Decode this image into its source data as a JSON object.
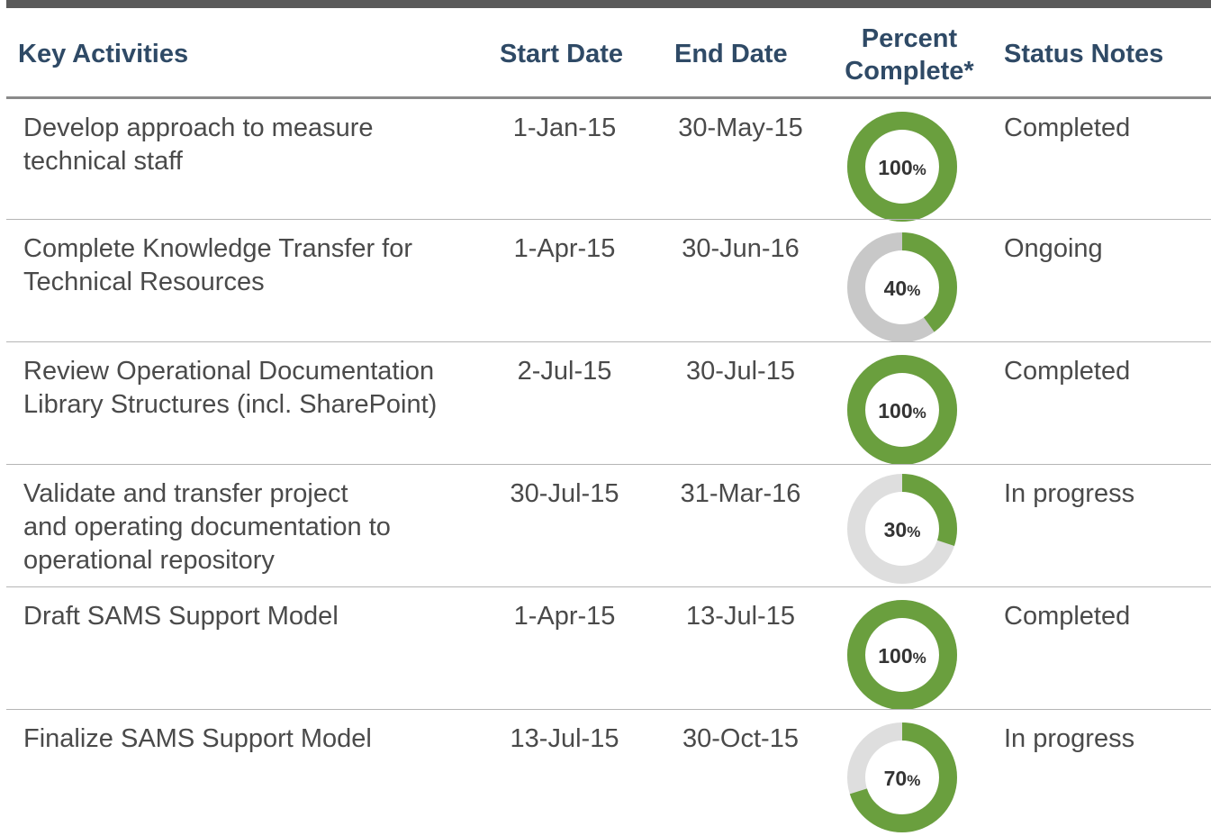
{
  "table": {
    "headers": {
      "activities": "Key Activities",
      "start": "Start Date",
      "end": "End Date",
      "percent_line1": "Percent",
      "percent_line2": "Complete*",
      "status": "Status Notes"
    },
    "rows": [
      {
        "activity_lines": [
          "Develop approach to measure",
          "technical staff"
        ],
        "start": "1-Jan-15",
        "end": "30-May-15",
        "percent": 100,
        "percent_text": "100",
        "status": "Completed",
        "track_color": "#c8c8c8"
      },
      {
        "activity_lines": [
          "Complete Knowledge Transfer for",
          "Technical Resources"
        ],
        "start": "1-Apr-15",
        "end": "30-Jun-16",
        "percent": 40,
        "percent_text": "40",
        "status": "Ongoing",
        "track_color": "#c8c8c8"
      },
      {
        "activity_lines": [
          "Review Operational Documentation",
          "Library Structures (incl. SharePoint)"
        ],
        "start": "2-Jul-15",
        "end": "30-Jul-15",
        "percent": 100,
        "percent_text": "100",
        "status": "Completed",
        "track_color": "#c8c8c8"
      },
      {
        "activity_lines": [
          "Validate and transfer project",
          "and operating documentation to",
          "operational repository"
        ],
        "start": "30-Jul-15",
        "end": "31-Mar-16",
        "percent": 30,
        "percent_text": "30",
        "status": "In progress",
        "track_color": "#dedede"
      },
      {
        "activity_lines": [
          "Draft SAMS Support Model"
        ],
        "start": "1-Apr-15",
        "end": "13-Jul-15",
        "percent": 100,
        "percent_text": "100",
        "status": "Completed",
        "track_color": "#c8c8c8"
      },
      {
        "activity_lines": [
          "Finalize SAMS Support Model"
        ],
        "start": "13-Jul-15",
        "end": "30-Oct-15",
        "percent": 70,
        "percent_text": "70",
        "status": "In progress",
        "track_color": "#dedede"
      }
    ],
    "percent_symbol": "%"
  },
  "colors": {
    "progress": "#6a9f3e",
    "header_text": "#2f4a66",
    "body_text": "#4a4a4a"
  }
}
